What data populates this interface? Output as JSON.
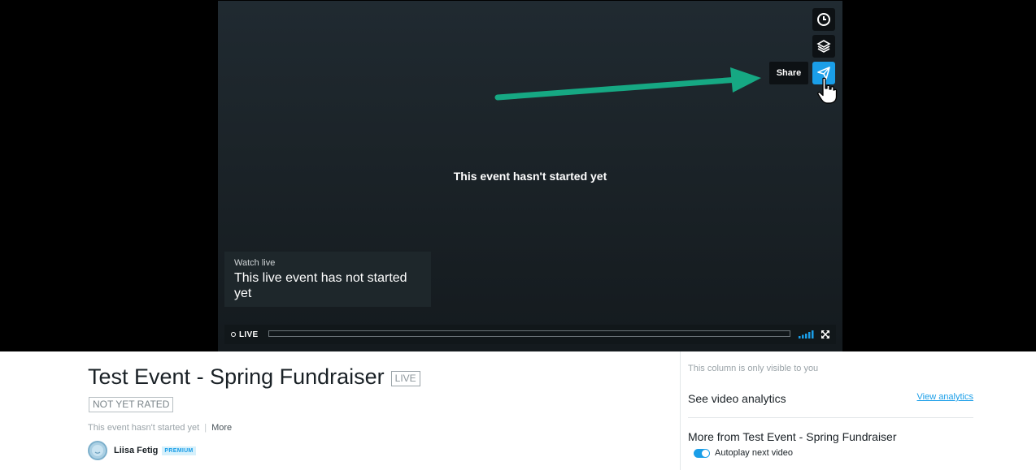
{
  "player": {
    "status_message": "This event hasn't started yet",
    "tooltip": "Share",
    "side_buttons": [
      {
        "icon": "clock-icon"
      },
      {
        "icon": "layers-icon"
      },
      {
        "icon": "paper-plane-icon",
        "active": true
      }
    ],
    "watch_box": {
      "label": "Watch live",
      "text": "This live event has not started yet"
    },
    "controls": {
      "live_label": "LIVE"
    },
    "accent_color": "#1a9ee8",
    "annotation_arrow_color": "#16a883"
  },
  "event": {
    "title": "Test Event - Spring Fundraiser",
    "live_badge": "LIVE",
    "rating": "NOT YET RATED",
    "status": "This event hasn't started yet",
    "more": "More",
    "owner": {
      "name": "Liisa Fetig",
      "badge": "PREMIUM"
    }
  },
  "sidebar": {
    "notice": "This column is only visible to you",
    "analytics_label": "See video analytics",
    "analytics_link": "View analytics",
    "more_from": "More from Test Event - Spring Fundraiser",
    "autoplay_label": "Autoplay next video",
    "autoplay_on": true
  }
}
